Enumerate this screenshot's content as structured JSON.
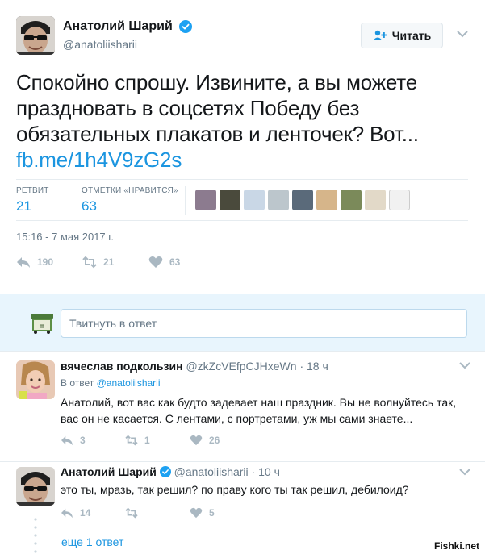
{
  "tweet": {
    "author_name": "Анатолий Шарий",
    "author_handle": "@anatoliisharii",
    "follow_label": "Читать",
    "text": "Спокойно спрошу. Извините, а вы можете праздновать в соцсетях Победу без обязательных плакатов и ленточек? Вот...",
    "link": "fb.me/1h4V9zG2s",
    "stats": {
      "retweets_label": "РЕТВИТ",
      "retweets_value": "21",
      "likes_label": "ОТМЕТКИ «НРАВИТСЯ»",
      "likes_value": "63"
    },
    "timestamp": "15:16 - 7 мая 2017 г.",
    "actions": {
      "replies": "190",
      "retweets": "21",
      "likes": "63"
    }
  },
  "reply_box": {
    "placeholder": "Твитнуть в ответ"
  },
  "replies": [
    {
      "name": "вячеслав подкользин",
      "handle": "@zkZcVEfpCJHxeWn",
      "time": "· 18 ч",
      "in_reply_prefix": "В ответ",
      "in_reply_to": "@anatoliisharii",
      "text": "Анатолий,  вот вас как будто задевает наш праздник. Вы не волнуйтесь так, вас он не касается. С лентами, с портретами, уж мы сами знаете...",
      "replies": "3",
      "retweets": "1",
      "likes": "26"
    },
    {
      "name": "Анатолий Шарий",
      "handle": "@anatoliisharii",
      "time": "· 10 ч",
      "text": "это ты, мразь, так решил? по праву кого ты так решил, дебилоид?",
      "replies": "14",
      "retweets": "",
      "likes": "5"
    }
  ],
  "more_replies": "еще 1 ответ",
  "watermark": "Fishki.net",
  "colors": {
    "link": "#1b95e0",
    "muted": "#657786",
    "icon": "#aab8c2",
    "reply_bar": "#e8f5fd"
  }
}
